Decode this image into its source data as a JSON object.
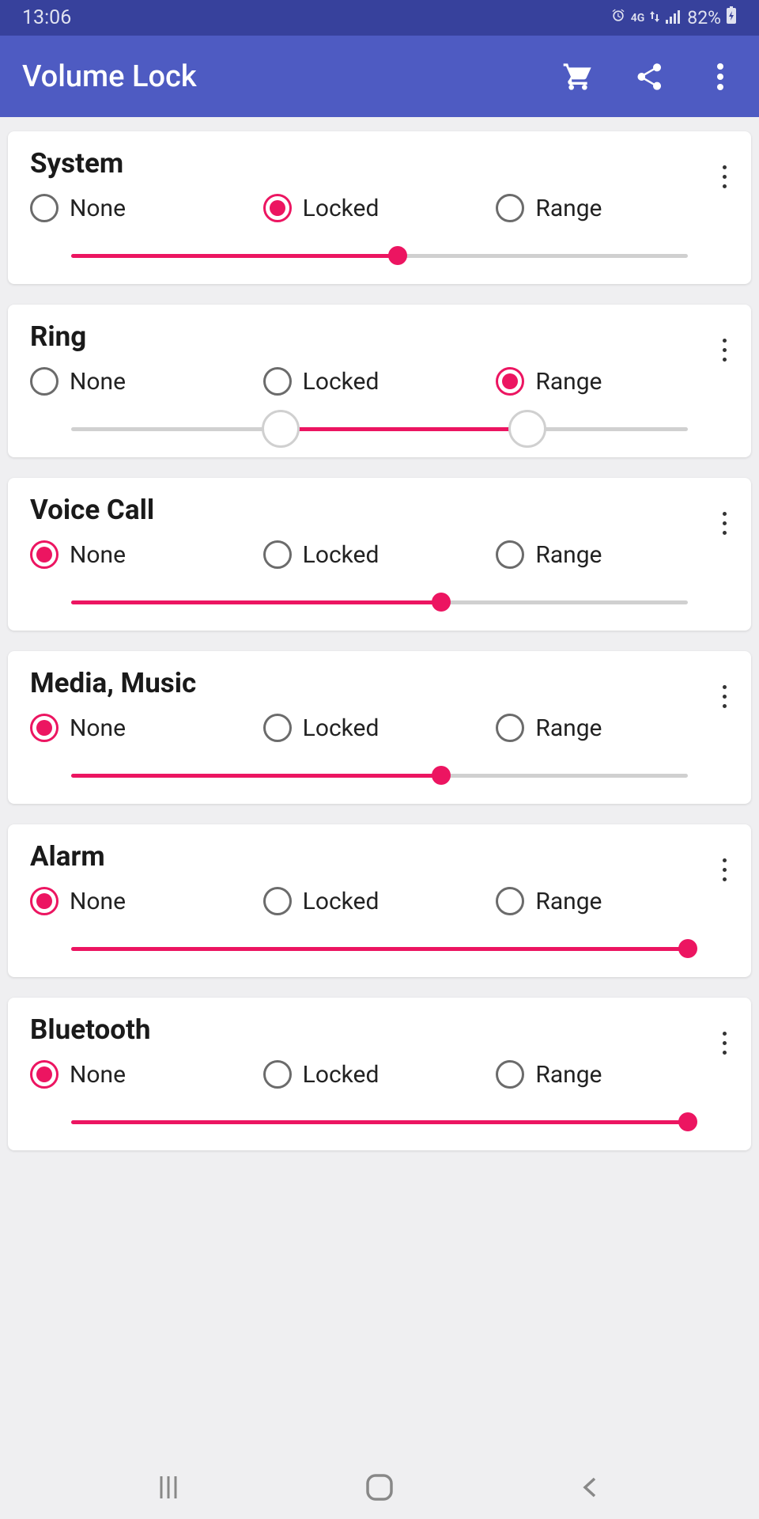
{
  "status": {
    "time": "13:06",
    "network": "4G",
    "battery": "82%"
  },
  "header": {
    "title": "Volume Lock"
  },
  "options": {
    "none": "None",
    "locked": "Locked",
    "range": "Range"
  },
  "cards": [
    {
      "title": "System",
      "selected": "locked",
      "slider": {
        "type": "single",
        "value": 53
      }
    },
    {
      "title": "Ring",
      "selected": "range",
      "slider": {
        "type": "range",
        "low": 34,
        "high": 74
      }
    },
    {
      "title": "Voice Call",
      "selected": "none",
      "slider": {
        "type": "single",
        "value": 60
      }
    },
    {
      "title": "Media, Music",
      "selected": "none",
      "slider": {
        "type": "single",
        "value": 60
      }
    },
    {
      "title": "Alarm",
      "selected": "none",
      "slider": {
        "type": "single",
        "value": 100
      }
    },
    {
      "title": "Bluetooth",
      "selected": "none",
      "slider": {
        "type": "single",
        "value": 100
      }
    }
  ]
}
